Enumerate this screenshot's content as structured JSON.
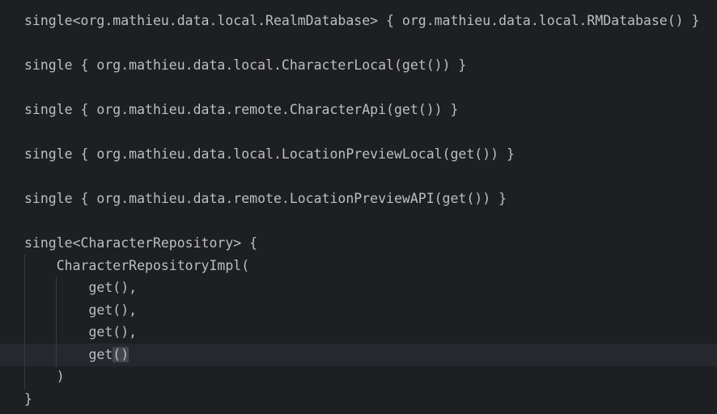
{
  "editor": {
    "colors": {
      "background": "#1e1f22",
      "text": "#bcbec4",
      "current_line": "#26282e",
      "indent_guide": "#393b40",
      "bracket_match": "#43454a"
    },
    "lines": [
      "single<org.mathieu.data.local.RealmDatabase> { org.mathieu.data.local.RMDatabase() }",
      "single { org.mathieu.data.local.CharacterLocal(get()) }",
      "single { org.mathieu.data.remote.CharacterApi(get()) }",
      "single { org.mathieu.data.local.LocationPreviewLocal(get()) }",
      "single { org.mathieu.data.remote.LocationPreviewAPI(get()) }",
      "single<CharacterRepository> {",
      "    CharacterRepositoryImpl(",
      "        get(),",
      "        get(),",
      "        get(),",
      "        get",
      "()",
      "    )",
      "}"
    ]
  }
}
